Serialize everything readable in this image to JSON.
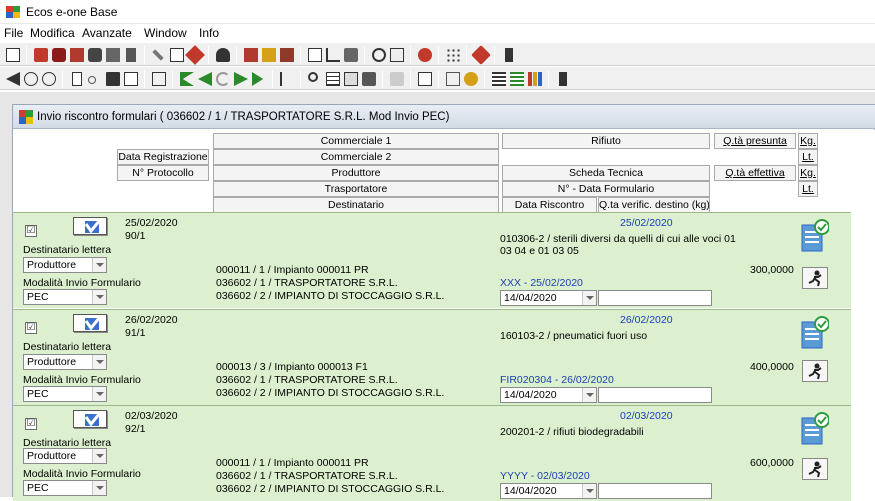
{
  "app": {
    "title": "Ecos e-one Base"
  },
  "menu": [
    "File",
    "Modifica",
    "Avanzate",
    "Window",
    "Info"
  ],
  "window": {
    "title": "Invio riscontro formulari ( 036602 / 1 / TRASPORTATORE S.R.L. Mod Invio PEC)"
  },
  "headers": {
    "data_registrazione": "Data Registrazione",
    "n_protocollo": "N° Protocollo",
    "commerciale1": "Commerciale 1",
    "commerciale2": "Commerciale 2",
    "produttore": "Produttore",
    "trasportatore": "Trasportatore",
    "destinatario": "Destinatario",
    "rifiuto": "Rifiuto",
    "scheda_tecnica": "Scheda Tecnica",
    "n_data_formulario": "N° - Data Formulario",
    "data_riscontro": "Data Riscontro",
    "qta_verific": "Q.ta verific. destino (kg)",
    "qta_presunta": "Q.tà presunta",
    "qta_effettiva": "Q.tà effettiva",
    "kg": "Kg.",
    "lt": "Lt."
  },
  "labels": {
    "destinatario_lettera": "Destinatario lettera",
    "modalita_invio": "Modalità Invio Formulario"
  },
  "records": [
    {
      "checked": "☑",
      "data": "25/02/2020",
      "protocollo": "90/1",
      "dest_lettera": "Produttore",
      "modalita": "PEC",
      "produttore": "000011 / 1 / Impianto 000011 PR",
      "trasportatore": "036602 / 1 / TRASPORTATORE S.R.L.",
      "destinatario": "036602 / 2 / IMPIANTO DI STOCCAGGIO S.R.L.",
      "rifiuto_data": "25/02/2020",
      "rifiuto": "010306-2 / sterili diversi da quelli di cui alle voci 01 03 04 e 01 03 05",
      "formulario": "XXX - 25/02/2020",
      "data_riscontro": "14/04/2020",
      "quantita": "300,0000"
    },
    {
      "checked": "☑",
      "data": "26/02/2020",
      "protocollo": "91/1",
      "dest_lettera": "Produttore",
      "modalita": "PEC",
      "produttore": "000013 / 3 / Impianto 000013 F1",
      "trasportatore": "036602 / 1 / TRASPORTATORE S.R.L.",
      "destinatario": "036602 / 2 / IMPIANTO DI STOCCAGGIO S.R.L.",
      "rifiuto_data": "26/02/2020",
      "rifiuto": "160103-2 / pneumatici fuori uso",
      "formulario": "FIR020304 - 26/02/2020",
      "data_riscontro": "14/04/2020",
      "quantita": "400,0000"
    },
    {
      "checked": "☑",
      "data": "02/03/2020",
      "protocollo": "92/1",
      "dest_lettera": "Produttore",
      "modalita": "PEC",
      "produttore": "000011 / 1 / Impianto 000011 PR",
      "trasportatore": "036602 / 1 / TRASPORTATORE S.R.L.",
      "destinatario": "036602 / 2 / IMPIANTO DI STOCCAGGIO S.R.L.",
      "rifiuto_data": "02/03/2020",
      "rifiuto": "200201-2 / rifiuti biodegradabili",
      "formulario": "YYYY - 02/03/2020",
      "data_riscontro": "14/04/2020",
      "quantita": "600,0000"
    }
  ],
  "colors": {
    "record_bg": "#dcf0cf",
    "link_blue": "#1a3fb0"
  }
}
